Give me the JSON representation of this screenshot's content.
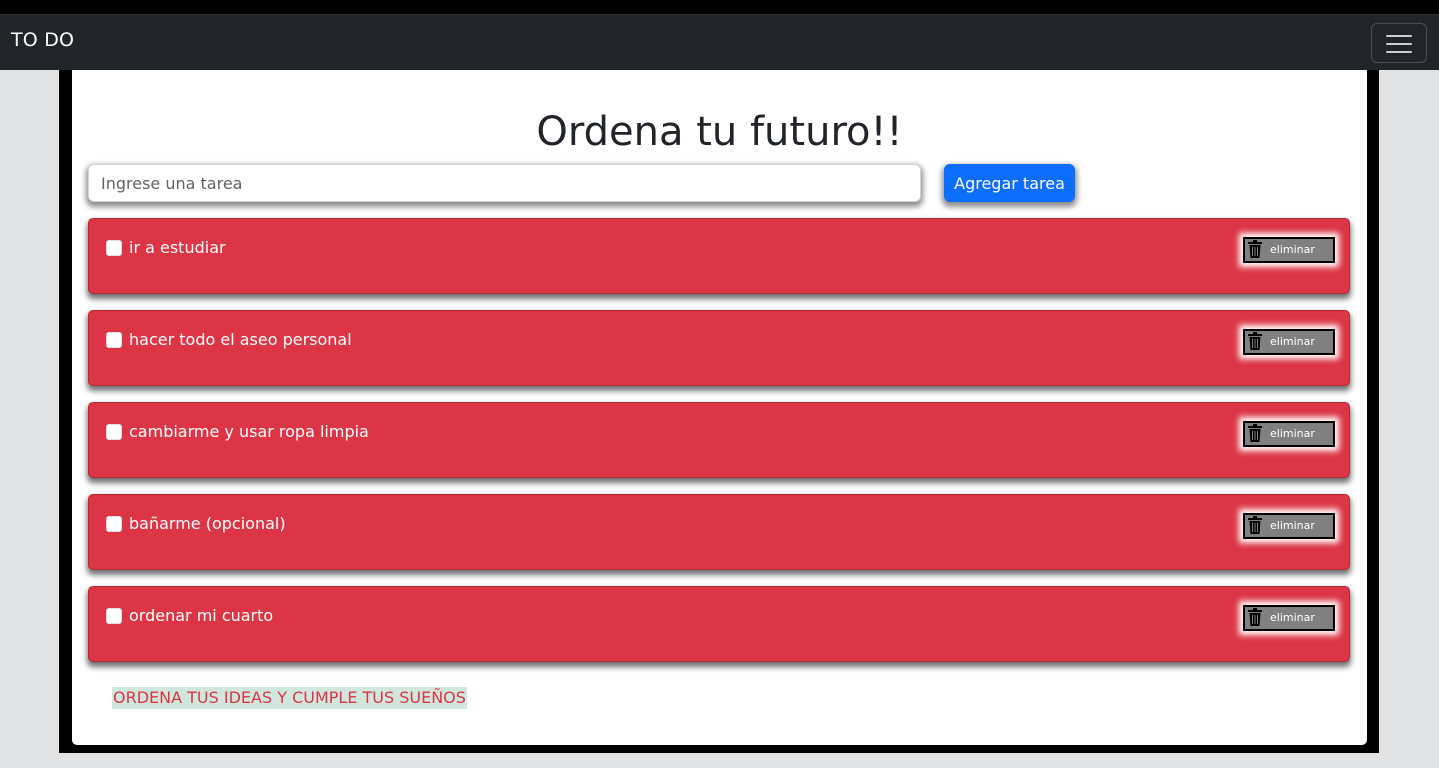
{
  "navbar": {
    "brand": "TO DO",
    "toggler_icon": "hamburger-menu-icon"
  },
  "main": {
    "title": "Ordena tu futuro!!",
    "input": {
      "value": "",
      "placeholder": "Ingrese una tarea"
    },
    "add_button": "Agregar tarea"
  },
  "tasks": [
    {
      "label": "ir a estudiar",
      "checked": false,
      "delete_label": "eliminar"
    },
    {
      "label": "hacer todo el aseo personal",
      "checked": false,
      "delete_label": "eliminar"
    },
    {
      "label": "cambiarme y usar ropa limpia",
      "checked": false,
      "delete_label": "eliminar"
    },
    {
      "label": "bañarme (opcional)",
      "checked": false,
      "delete_label": "eliminar"
    },
    {
      "label": "ordenar mi cuarto",
      "checked": false,
      "delete_label": "eliminar"
    }
  ],
  "footer": {
    "text": "ORDENA TUS IDEAS Y CUMPLE TUS SUEÑOS"
  },
  "colors": {
    "navbar": "#212529",
    "task": "#dc3545",
    "primary": "#0d6efd",
    "delete_button": "#808080",
    "footer_bg": "#d1e7dd"
  },
  "icons": {
    "delete": "trash-icon"
  }
}
